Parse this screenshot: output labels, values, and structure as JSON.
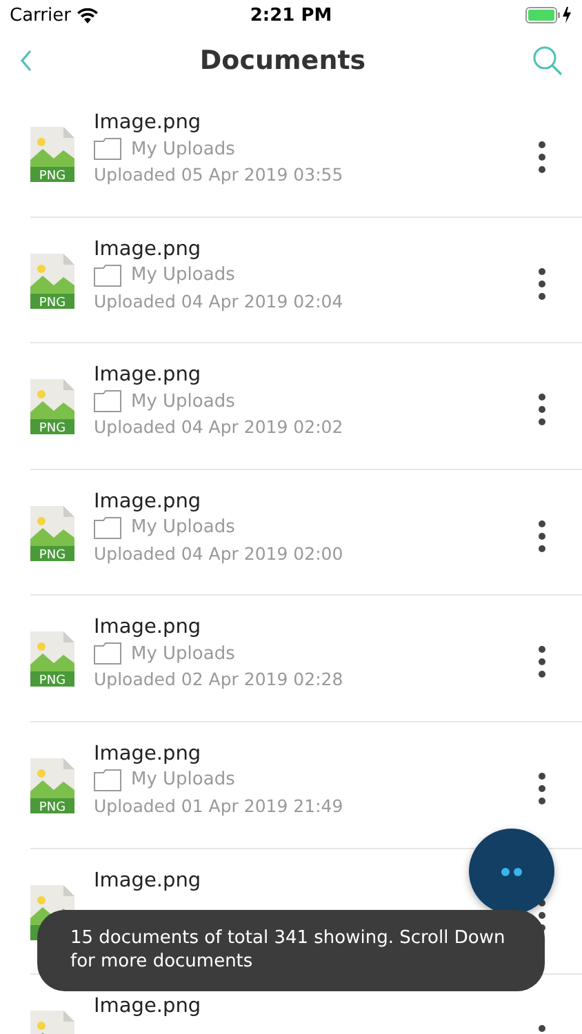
{
  "status_bar": {
    "carrier": "Carrier",
    "time": "2:21 PM"
  },
  "nav": {
    "title": "Documents"
  },
  "documents": [
    {
      "name": "Image.png",
      "type_label": "PNG",
      "folder": "My Uploads",
      "uploaded": "Uploaded 05 Apr 2019 03:55"
    },
    {
      "name": "Image.png",
      "type_label": "PNG",
      "folder": "My Uploads",
      "uploaded": "Uploaded 04 Apr 2019 02:04"
    },
    {
      "name": "Image.png",
      "type_label": "PNG",
      "folder": "My Uploads",
      "uploaded": "Uploaded 04 Apr 2019 02:02"
    },
    {
      "name": "Image.png",
      "type_label": "PNG",
      "folder": "My Uploads",
      "uploaded": "Uploaded 04 Apr 2019 02:00"
    },
    {
      "name": "Image.png",
      "type_label": "PNG",
      "folder": "My Uploads",
      "uploaded": "Uploaded 02 Apr 2019 02:28"
    },
    {
      "name": "Image.png",
      "type_label": "PNG",
      "folder": "My Uploads",
      "uploaded": "Uploaded 01 Apr 2019 21:49"
    },
    {
      "name": "Image.png"
    },
    {
      "name": "Image.png"
    }
  ],
  "toast": "15 documents of total 341 showing. Scroll Down for more documents"
}
